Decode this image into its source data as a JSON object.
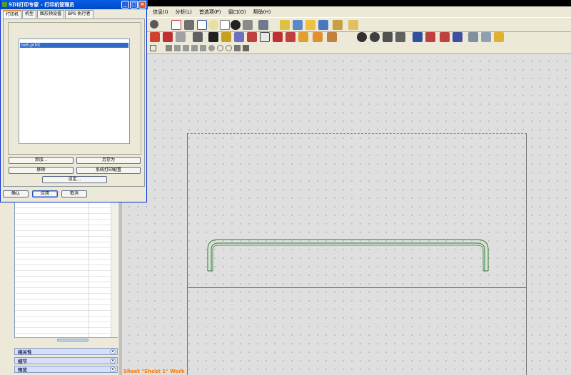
{
  "dialog": {
    "title": "SDI打印专家 - 打印机管理员",
    "tabs": [
      "打印机",
      "机型",
      "图形预设值",
      "BPS 执行者"
    ],
    "printers": [
      "ne6.print"
    ],
    "buttons": {
      "add": "添加...",
      "save_as": "另存为",
      "remove": "移除",
      "system_print_config": "系统打印配置",
      "setup": "设定...",
      "ok": "确认",
      "apply": "应用",
      "cancel": "取消"
    },
    "window_buttons": {
      "minimize": "_",
      "maximize": "□",
      "close": "×"
    }
  },
  "menubar": {
    "items": [
      "信息(I)",
      "分析(L)",
      "首选项(P)",
      "窗口(O)",
      "帮助(H)"
    ]
  },
  "left_panel": {
    "sections": [
      "相关性",
      "细节",
      "预览"
    ]
  },
  "drawing": {
    "status": "Sheet \"Sheet 1\" Work"
  },
  "colors": {
    "part_outline": "#2e7d2e",
    "status_text": "#ff7a00",
    "titlebar": "#0256d8"
  }
}
